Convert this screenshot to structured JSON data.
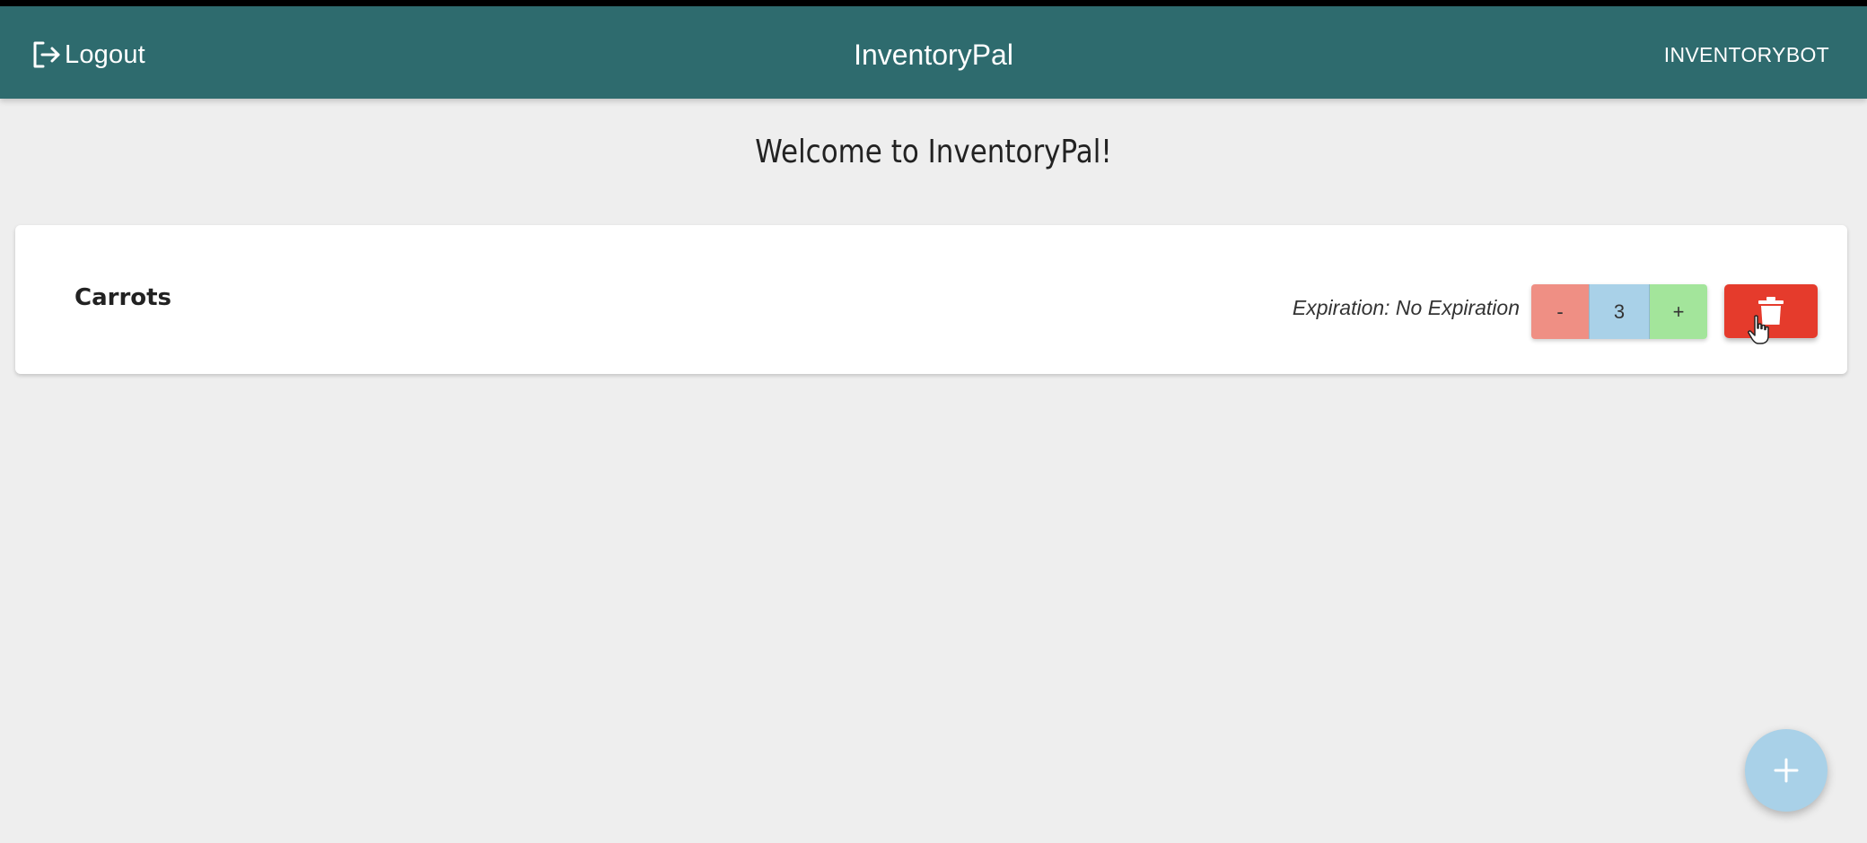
{
  "header": {
    "logout_label": "Logout",
    "logout_icon": "logout-icon",
    "title": "InventoryPal",
    "username": "INVENTORYBOT"
  },
  "main": {
    "welcome": "Welcome to InventoryPal!",
    "items": [
      {
        "name": "Carrots",
        "expiration": "Expiration: No Expiration",
        "decrement_label": "-",
        "quantity": "3",
        "increment_label": "+",
        "delete_icon": "trash-icon"
      }
    ]
  },
  "fab": {
    "icon": "plus-icon"
  },
  "colors": {
    "header_bg": "#2e6b6e",
    "page_bg": "#eeeeee",
    "decrement_bg": "#ef8f84",
    "quantity_bg": "#a9d1e8",
    "increment_bg": "#a3e59b",
    "delete_bg": "#e53b2c",
    "fab_bg": "#a9d1e8"
  }
}
